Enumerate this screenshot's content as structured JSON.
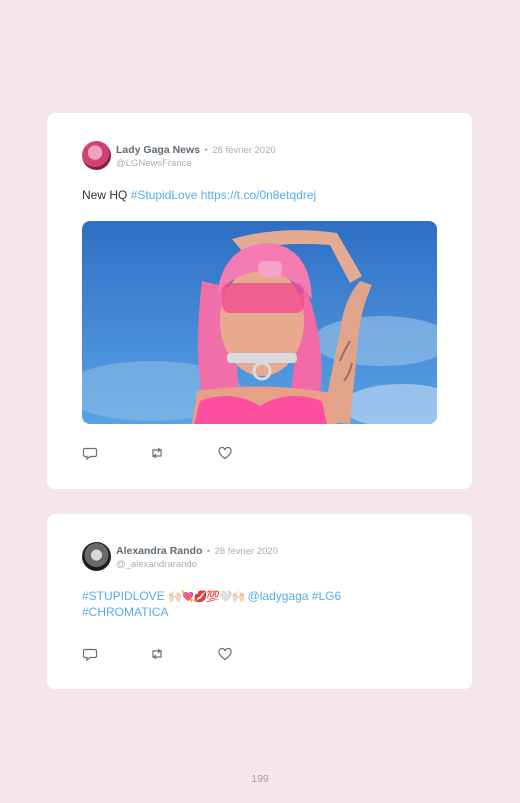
{
  "tweets": [
    {
      "author": "Lady Gaga News",
      "separator": "•",
      "date": "28 février 2020",
      "handle": "@LGNewsFrance",
      "text_plain": "New HQ ",
      "hashtag": "#StupidLove",
      "url": "https://t.co/0n8etqdrej",
      "has_photo": true
    },
    {
      "author": "Alexandra Rando",
      "separator": "•",
      "date": "28 février 2020",
      "handle": "@_alexandrarando",
      "hashtag1": "#STUPIDLOVE",
      "emojis": "🙌🏻💘💋💯🤍🙌🏻",
      "mention": "@ladygaga",
      "hashtag2": "#LG6",
      "hashtag3": "#CHROMATICA"
    }
  ],
  "icons": [
    "reply-icon",
    "retweet-icon",
    "like-icon"
  ],
  "colors": {
    "link": "#55acee",
    "background": "#f5e6ea"
  },
  "page_number": "199"
}
